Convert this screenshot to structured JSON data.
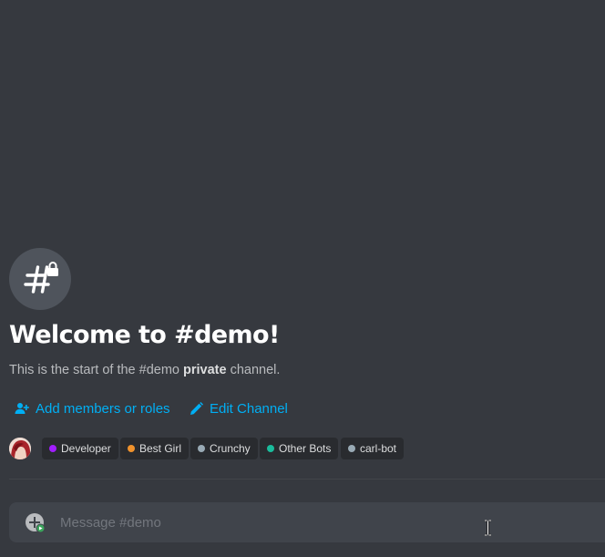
{
  "channel_header": {
    "icon": "hashtag-lock-icon",
    "title": "Welcome to #demo!",
    "subtitle_prefix": "This is the start of the #demo ",
    "subtitle_bold": "private",
    "subtitle_suffix": " channel."
  },
  "actions": {
    "add_members": {
      "label": "Add members or roles",
      "icon": "add-members-icon"
    },
    "edit_channel": {
      "label": "Edit Channel",
      "icon": "pencil-icon"
    }
  },
  "roles": [
    {
      "label": "Developer",
      "color": "#a11dff"
    },
    {
      "label": "Best Girl",
      "color": "#f0922c"
    },
    {
      "label": "Crunchy",
      "color": "#99aab5"
    },
    {
      "label": "Other Bots",
      "color": "#1abc9c"
    },
    {
      "label": "carl-bot",
      "color": "#99aab5"
    }
  ],
  "composer": {
    "placeholder": "Message #demo",
    "value": "",
    "attach_icon": "plus-circle-icon"
  },
  "colors": {
    "background": "#36393f",
    "link": "#00aff4",
    "pill_bg": "#292b2f",
    "composer_bg": "#40444b"
  }
}
